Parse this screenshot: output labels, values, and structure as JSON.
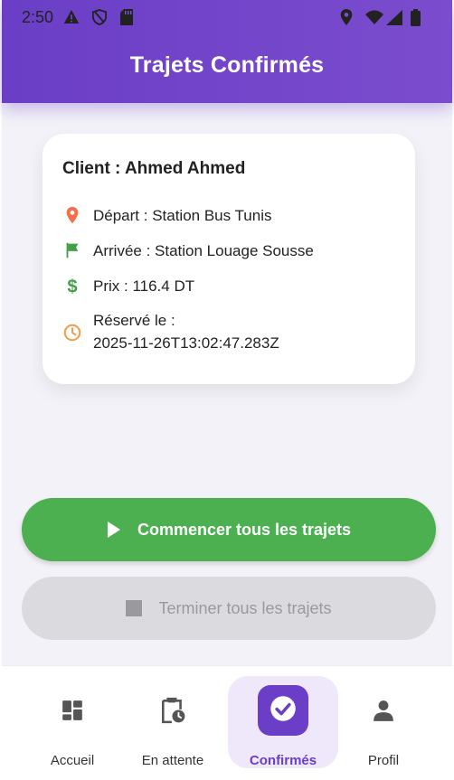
{
  "status_bar": {
    "time": "2:50"
  },
  "header": {
    "title": "Trajets Confirmés"
  },
  "card": {
    "client": "Client : Ahmed Ahmed",
    "depart": "Départ : Station Bus Tunis",
    "arrivee": "Arrivée : Station Louage Sousse",
    "prix": "Prix : 116.4 DT",
    "reserve_label": "Réservé le :",
    "reserve_date": "2025-11-26T13:02:47.283Z"
  },
  "buttons": {
    "start_all": "Commencer tous les trajets",
    "end_all": "Terminer tous les trajets"
  },
  "nav": {
    "items": [
      {
        "label": "Accueil",
        "icon": "dashboard-icon"
      },
      {
        "label": "En attente",
        "icon": "pending-clipboard-icon"
      },
      {
        "label": "Confirmés",
        "icon": "check-circle-icon"
      },
      {
        "label": "Profil",
        "icon": "person-icon"
      }
    ],
    "active_index": 2
  },
  "colors": {
    "primary": "#6a3ec6",
    "success": "#4caf50",
    "disabled_bg": "#dbdadf",
    "location_pin": "#f4704b",
    "flag": "#43a047",
    "clock": "#f59a45"
  }
}
